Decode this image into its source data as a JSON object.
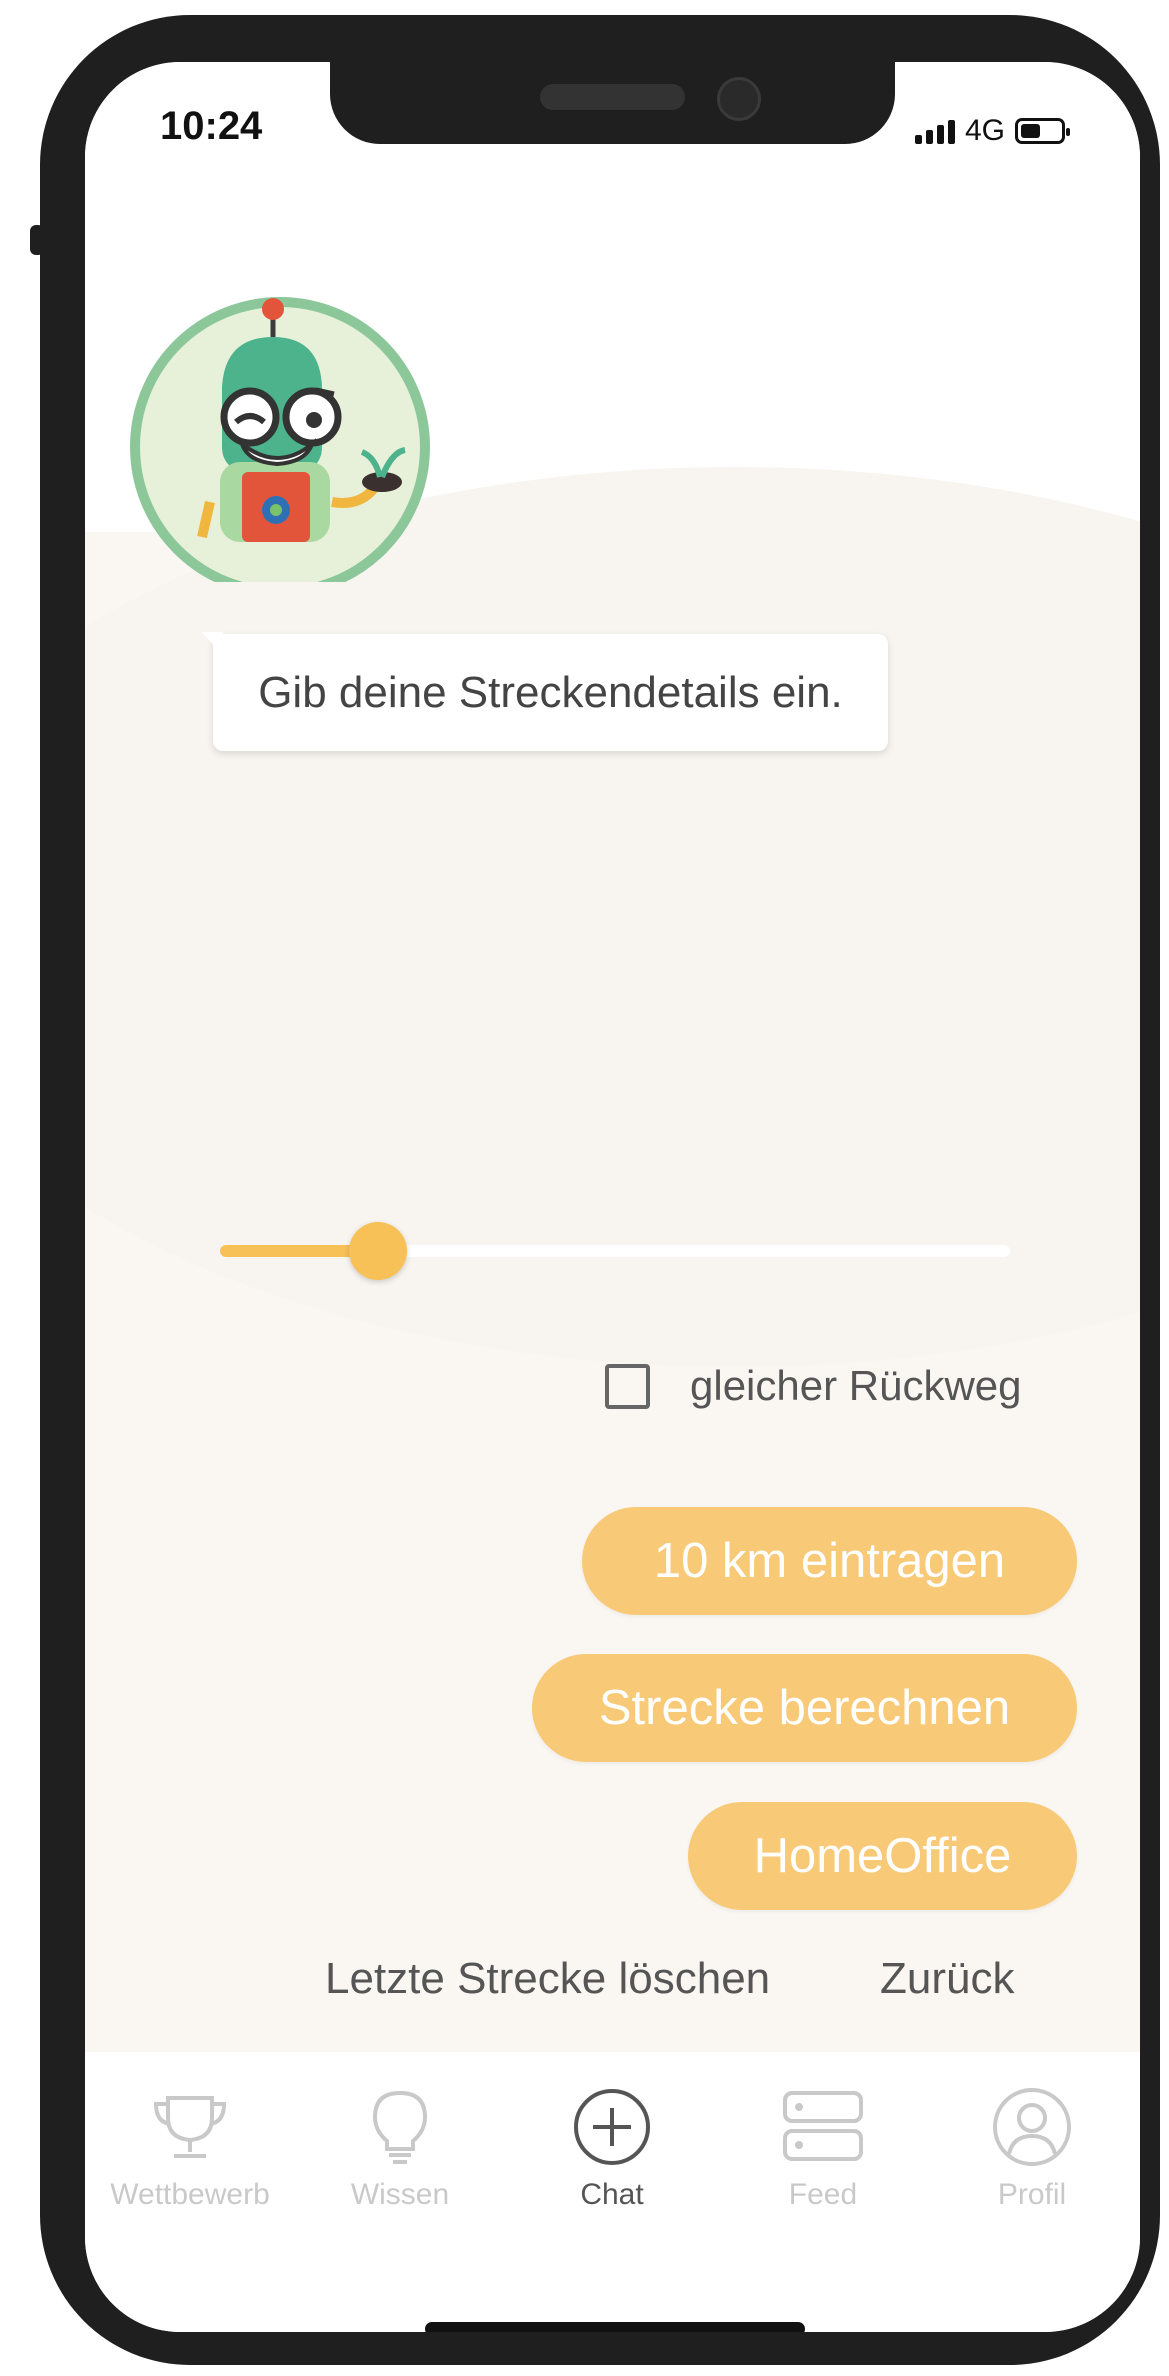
{
  "status_bar": {
    "time": "10:24",
    "network": "4G",
    "battery_level": 0.55
  },
  "chat": {
    "message": "Gib deine Streckendetails ein."
  },
  "distance_slider": {
    "value_fraction": 0.2
  },
  "return_trip": {
    "label": "gleicher Rückweg",
    "checked": false
  },
  "actions": {
    "enter_distance": "10 km  eintragen",
    "calculate_route": "Strecke berechnen",
    "home_office": "HomeOffice",
    "delete_last": "Letzte Strecke löschen",
    "back": "Zurück"
  },
  "tabs": [
    {
      "label": "Wettbewerb",
      "icon": "trophy-icon",
      "active": false
    },
    {
      "label": "Wissen",
      "icon": "lightbulb-icon",
      "active": false
    },
    {
      "label": "Chat",
      "icon": "plus-circle-icon",
      "active": true
    },
    {
      "label": "Feed",
      "icon": "feed-icon",
      "active": false
    },
    {
      "label": "Profil",
      "icon": "profile-icon",
      "active": false
    }
  ],
  "colors": {
    "accent": "#f7c157",
    "button": "#f8c977",
    "background": "#faf7f3",
    "frame": "#1f1f1f"
  }
}
